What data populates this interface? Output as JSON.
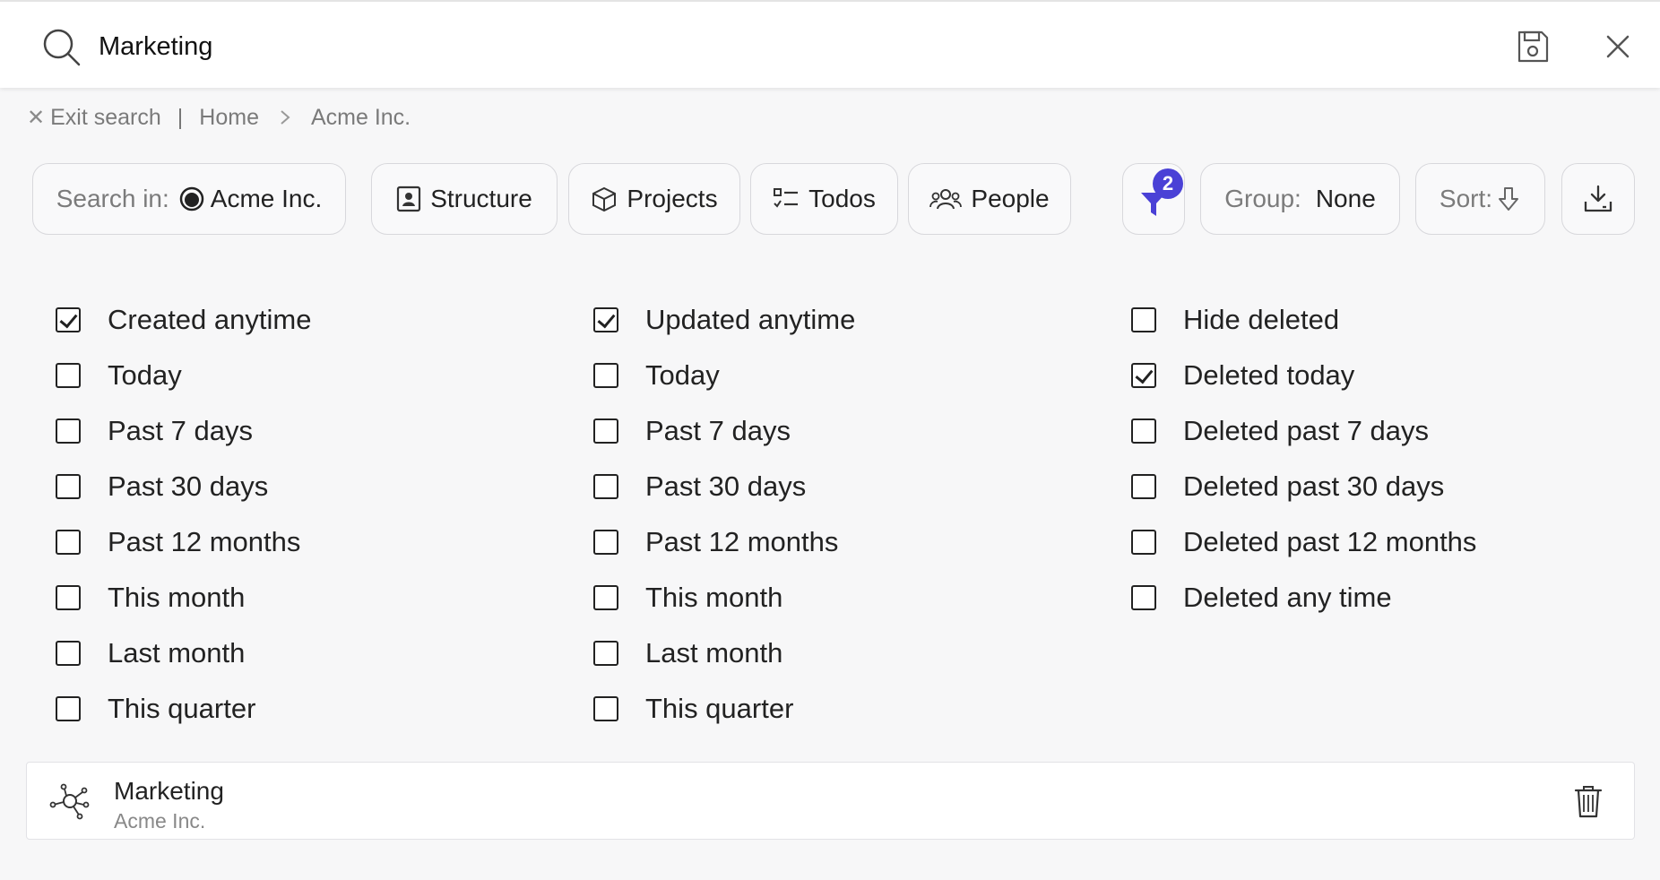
{
  "search": {
    "query": "Marketing"
  },
  "breadcrumb": {
    "exit_label": "Exit search",
    "separator": "|",
    "items": [
      "Home",
      "Acme Inc."
    ]
  },
  "toolbar": {
    "search_in_label": "Search in:",
    "search_in_value": "Acme Inc.",
    "structure_label": "Structure",
    "projects_label": "Projects",
    "todos_label": "Todos",
    "people_label": "People",
    "filter_count": "2",
    "group_label": "Group:",
    "group_value": "None",
    "sort_label": "Sort:"
  },
  "filters": {
    "created": [
      {
        "label": "Created anytime",
        "checked": true
      },
      {
        "label": "Today",
        "checked": false
      },
      {
        "label": "Past 7 days",
        "checked": false
      },
      {
        "label": "Past 30 days",
        "checked": false
      },
      {
        "label": "Past 12 months",
        "checked": false
      },
      {
        "label": "This month",
        "checked": false
      },
      {
        "label": "Last month",
        "checked": false
      },
      {
        "label": "This quarter",
        "checked": false
      }
    ],
    "updated": [
      {
        "label": "Updated anytime",
        "checked": true
      },
      {
        "label": "Today",
        "checked": false
      },
      {
        "label": "Past 7 days",
        "checked": false
      },
      {
        "label": "Past 30 days",
        "checked": false
      },
      {
        "label": "Past 12 months",
        "checked": false
      },
      {
        "label": "This month",
        "checked": false
      },
      {
        "label": "Last month",
        "checked": false
      },
      {
        "label": "This quarter",
        "checked": false
      }
    ],
    "deleted": [
      {
        "label": "Hide deleted",
        "checked": false
      },
      {
        "label": "Deleted today",
        "checked": true
      },
      {
        "label": "Deleted past 7 days",
        "checked": false
      },
      {
        "label": "Deleted past 30 days",
        "checked": false
      },
      {
        "label": "Deleted past 12 months",
        "checked": false
      },
      {
        "label": "Deleted any time",
        "checked": false
      }
    ]
  },
  "results": [
    {
      "title": "Marketing",
      "subtitle": "Acme Inc."
    }
  ],
  "colors": {
    "badge": "#4a41d6",
    "text": "#222222",
    "muted": "#7a7a7a"
  }
}
